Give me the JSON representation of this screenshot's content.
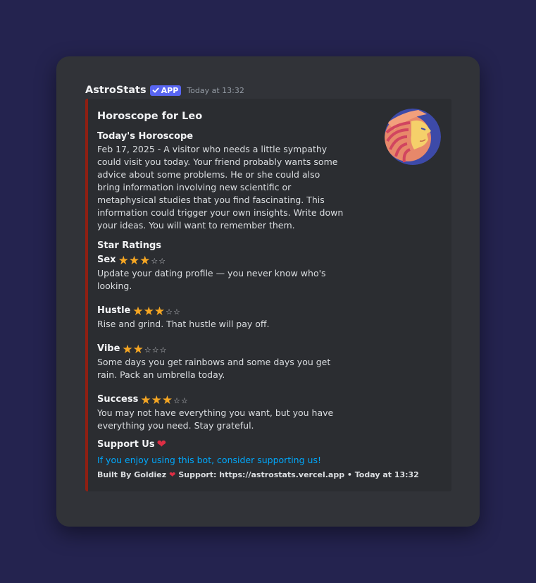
{
  "message": {
    "username": "AstroStats",
    "badge": "APP",
    "timestamp": "Today at 13:32"
  },
  "embed": {
    "title": "Horoscope for Leo",
    "accent_color": "#8f1f12",
    "thumbnail_icon": "leo-lion-icon",
    "horoscope_label": "Today's Horoscope",
    "horoscope_text": "Feb 17, 2025 - A visitor who needs a little sympathy could visit you today. Your friend probably wants some advice about some problems. He or she could also bring information involving new scientific or metaphysical studies that you find fascinating. This information could trigger your own insights. Write down your ideas. You will want to remember them.",
    "ratings_label": "Star Ratings",
    "ratings": [
      {
        "name": "Sex",
        "stars": 3,
        "max": 5,
        "text": "Update your dating profile — you never know who's looking."
      },
      {
        "name": "Hustle",
        "stars": 3,
        "max": 5,
        "text": "Rise and grind. That hustle will pay off."
      },
      {
        "name": "Vibe",
        "stars": 2,
        "max": 5,
        "text": "Some days you get rainbows and some days you get rain. Pack an umbrella today."
      },
      {
        "name": "Success",
        "stars": 3,
        "max": 5,
        "text": "You may not have everything you want, but you have everything you need. Stay grateful."
      }
    ],
    "support_label": "Support Us",
    "support_link": "If you enjoy using this bot, consider supporting us!",
    "footer": {
      "built_by": "Built By Goldiez",
      "support": "Support: https://astrostats.vercel.app • Today at 13:32"
    }
  },
  "colors": {
    "background": "#24234f",
    "card": "#313338",
    "embed": "#2b2d31",
    "badge": "#5865f2",
    "link": "#00a8fc",
    "star": "#f5a623",
    "heart": "#dd2e44"
  }
}
